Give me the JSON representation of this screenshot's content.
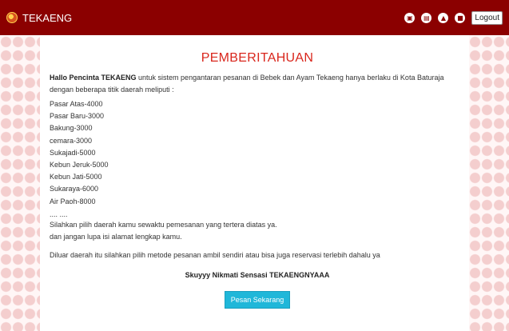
{
  "header": {
    "brand": "TEKAENG",
    "icons": [
      "cart-icon",
      "orders-icon",
      "notification-icon",
      "profile-icon"
    ],
    "logout_label": "Logout",
    "background_color": "#8b0000"
  },
  "main": {
    "title": "PEMBERITAHUAN",
    "intro_bold": "Hallo Pencinta TEKAENG",
    "intro_text": " untuk sistem pengantaran pesanan di Bebek dan Ayam Tekaeng hanya berlaku di Kota Baturaja dengan beberapa titik daerah meliputi :",
    "areas": [
      "Pasar Atas-4000",
      "Pasar Baru-3000",
      "Bakung-3000",
      "cemara-3000",
      "Sukajadi-5000",
      "Kebun Jeruk-5000",
      "Kebun Jati-5000",
      "Sukaraya-6000",
      "Air Paoh-8000"
    ],
    "ellipsis": ".... ....",
    "instruction_1": "Silahkan pilih daerah kamu sewaktu pemesanan yang tertera diatas ya.",
    "instruction_2": "dan jangan lupa isi alamat lengkap kamu.",
    "outro": "Diluar daerah itu silahkan pilih metode pesanan ambil sendiri atau bisa juga reservasi terlebih dahalu ya",
    "tagline": "Skuyyy Nikmati Sensasi TEKAENGNYAAA",
    "cta_label": "Pesan Sekarang",
    "title_color": "#d9261c",
    "cta_color": "#1fb7d9"
  }
}
